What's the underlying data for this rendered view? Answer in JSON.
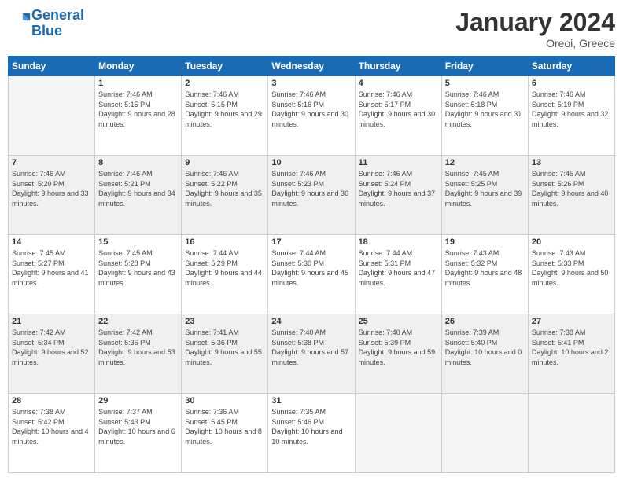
{
  "logo": {
    "line1": "General",
    "line2": "Blue"
  },
  "header": {
    "month": "January 2024",
    "location": "Oreoi, Greece"
  },
  "weekdays": [
    "Sunday",
    "Monday",
    "Tuesday",
    "Wednesday",
    "Thursday",
    "Friday",
    "Saturday"
  ],
  "weeks": [
    [
      {
        "day": "",
        "sunrise": "",
        "sunset": "",
        "daylight": "",
        "empty": true
      },
      {
        "day": "1",
        "sunrise": "7:46 AM",
        "sunset": "5:15 PM",
        "daylight": "9 hours and 28 minutes."
      },
      {
        "day": "2",
        "sunrise": "7:46 AM",
        "sunset": "5:15 PM",
        "daylight": "9 hours and 29 minutes."
      },
      {
        "day": "3",
        "sunrise": "7:46 AM",
        "sunset": "5:16 PM",
        "daylight": "9 hours and 30 minutes."
      },
      {
        "day": "4",
        "sunrise": "7:46 AM",
        "sunset": "5:17 PM",
        "daylight": "9 hours and 30 minutes."
      },
      {
        "day": "5",
        "sunrise": "7:46 AM",
        "sunset": "5:18 PM",
        "daylight": "9 hours and 31 minutes."
      },
      {
        "day": "6",
        "sunrise": "7:46 AM",
        "sunset": "5:19 PM",
        "daylight": "9 hours and 32 minutes."
      }
    ],
    [
      {
        "day": "7",
        "sunrise": "7:46 AM",
        "sunset": "5:20 PM",
        "daylight": "9 hours and 33 minutes."
      },
      {
        "day": "8",
        "sunrise": "7:46 AM",
        "sunset": "5:21 PM",
        "daylight": "9 hours and 34 minutes."
      },
      {
        "day": "9",
        "sunrise": "7:46 AM",
        "sunset": "5:22 PM",
        "daylight": "9 hours and 35 minutes."
      },
      {
        "day": "10",
        "sunrise": "7:46 AM",
        "sunset": "5:23 PM",
        "daylight": "9 hours and 36 minutes."
      },
      {
        "day": "11",
        "sunrise": "7:46 AM",
        "sunset": "5:24 PM",
        "daylight": "9 hours and 37 minutes."
      },
      {
        "day": "12",
        "sunrise": "7:45 AM",
        "sunset": "5:25 PM",
        "daylight": "9 hours and 39 minutes."
      },
      {
        "day": "13",
        "sunrise": "7:45 AM",
        "sunset": "5:26 PM",
        "daylight": "9 hours and 40 minutes."
      }
    ],
    [
      {
        "day": "14",
        "sunrise": "7:45 AM",
        "sunset": "5:27 PM",
        "daylight": "9 hours and 41 minutes."
      },
      {
        "day": "15",
        "sunrise": "7:45 AM",
        "sunset": "5:28 PM",
        "daylight": "9 hours and 43 minutes."
      },
      {
        "day": "16",
        "sunrise": "7:44 AM",
        "sunset": "5:29 PM",
        "daylight": "9 hours and 44 minutes."
      },
      {
        "day": "17",
        "sunrise": "7:44 AM",
        "sunset": "5:30 PM",
        "daylight": "9 hours and 45 minutes."
      },
      {
        "day": "18",
        "sunrise": "7:44 AM",
        "sunset": "5:31 PM",
        "daylight": "9 hours and 47 minutes."
      },
      {
        "day": "19",
        "sunrise": "7:43 AM",
        "sunset": "5:32 PM",
        "daylight": "9 hours and 48 minutes."
      },
      {
        "day": "20",
        "sunrise": "7:43 AM",
        "sunset": "5:33 PM",
        "daylight": "9 hours and 50 minutes."
      }
    ],
    [
      {
        "day": "21",
        "sunrise": "7:42 AM",
        "sunset": "5:34 PM",
        "daylight": "9 hours and 52 minutes."
      },
      {
        "day": "22",
        "sunrise": "7:42 AM",
        "sunset": "5:35 PM",
        "daylight": "9 hours and 53 minutes."
      },
      {
        "day": "23",
        "sunrise": "7:41 AM",
        "sunset": "5:36 PM",
        "daylight": "9 hours and 55 minutes."
      },
      {
        "day": "24",
        "sunrise": "7:40 AM",
        "sunset": "5:38 PM",
        "daylight": "9 hours and 57 minutes."
      },
      {
        "day": "25",
        "sunrise": "7:40 AM",
        "sunset": "5:39 PM",
        "daylight": "9 hours and 59 minutes."
      },
      {
        "day": "26",
        "sunrise": "7:39 AM",
        "sunset": "5:40 PM",
        "daylight": "10 hours and 0 minutes."
      },
      {
        "day": "27",
        "sunrise": "7:38 AM",
        "sunset": "5:41 PM",
        "daylight": "10 hours and 2 minutes."
      }
    ],
    [
      {
        "day": "28",
        "sunrise": "7:38 AM",
        "sunset": "5:42 PM",
        "daylight": "10 hours and 4 minutes."
      },
      {
        "day": "29",
        "sunrise": "7:37 AM",
        "sunset": "5:43 PM",
        "daylight": "10 hours and 6 minutes."
      },
      {
        "day": "30",
        "sunrise": "7:36 AM",
        "sunset": "5:45 PM",
        "daylight": "10 hours and 8 minutes."
      },
      {
        "day": "31",
        "sunrise": "7:35 AM",
        "sunset": "5:46 PM",
        "daylight": "10 hours and 10 minutes."
      },
      {
        "day": "",
        "sunrise": "",
        "sunset": "",
        "daylight": "",
        "empty": true
      },
      {
        "day": "",
        "sunrise": "",
        "sunset": "",
        "daylight": "",
        "empty": true
      },
      {
        "day": "",
        "sunrise": "",
        "sunset": "",
        "daylight": "",
        "empty": true
      }
    ]
  ],
  "labels": {
    "sunrise": "Sunrise:",
    "sunset": "Sunset:",
    "daylight": "Daylight:"
  }
}
